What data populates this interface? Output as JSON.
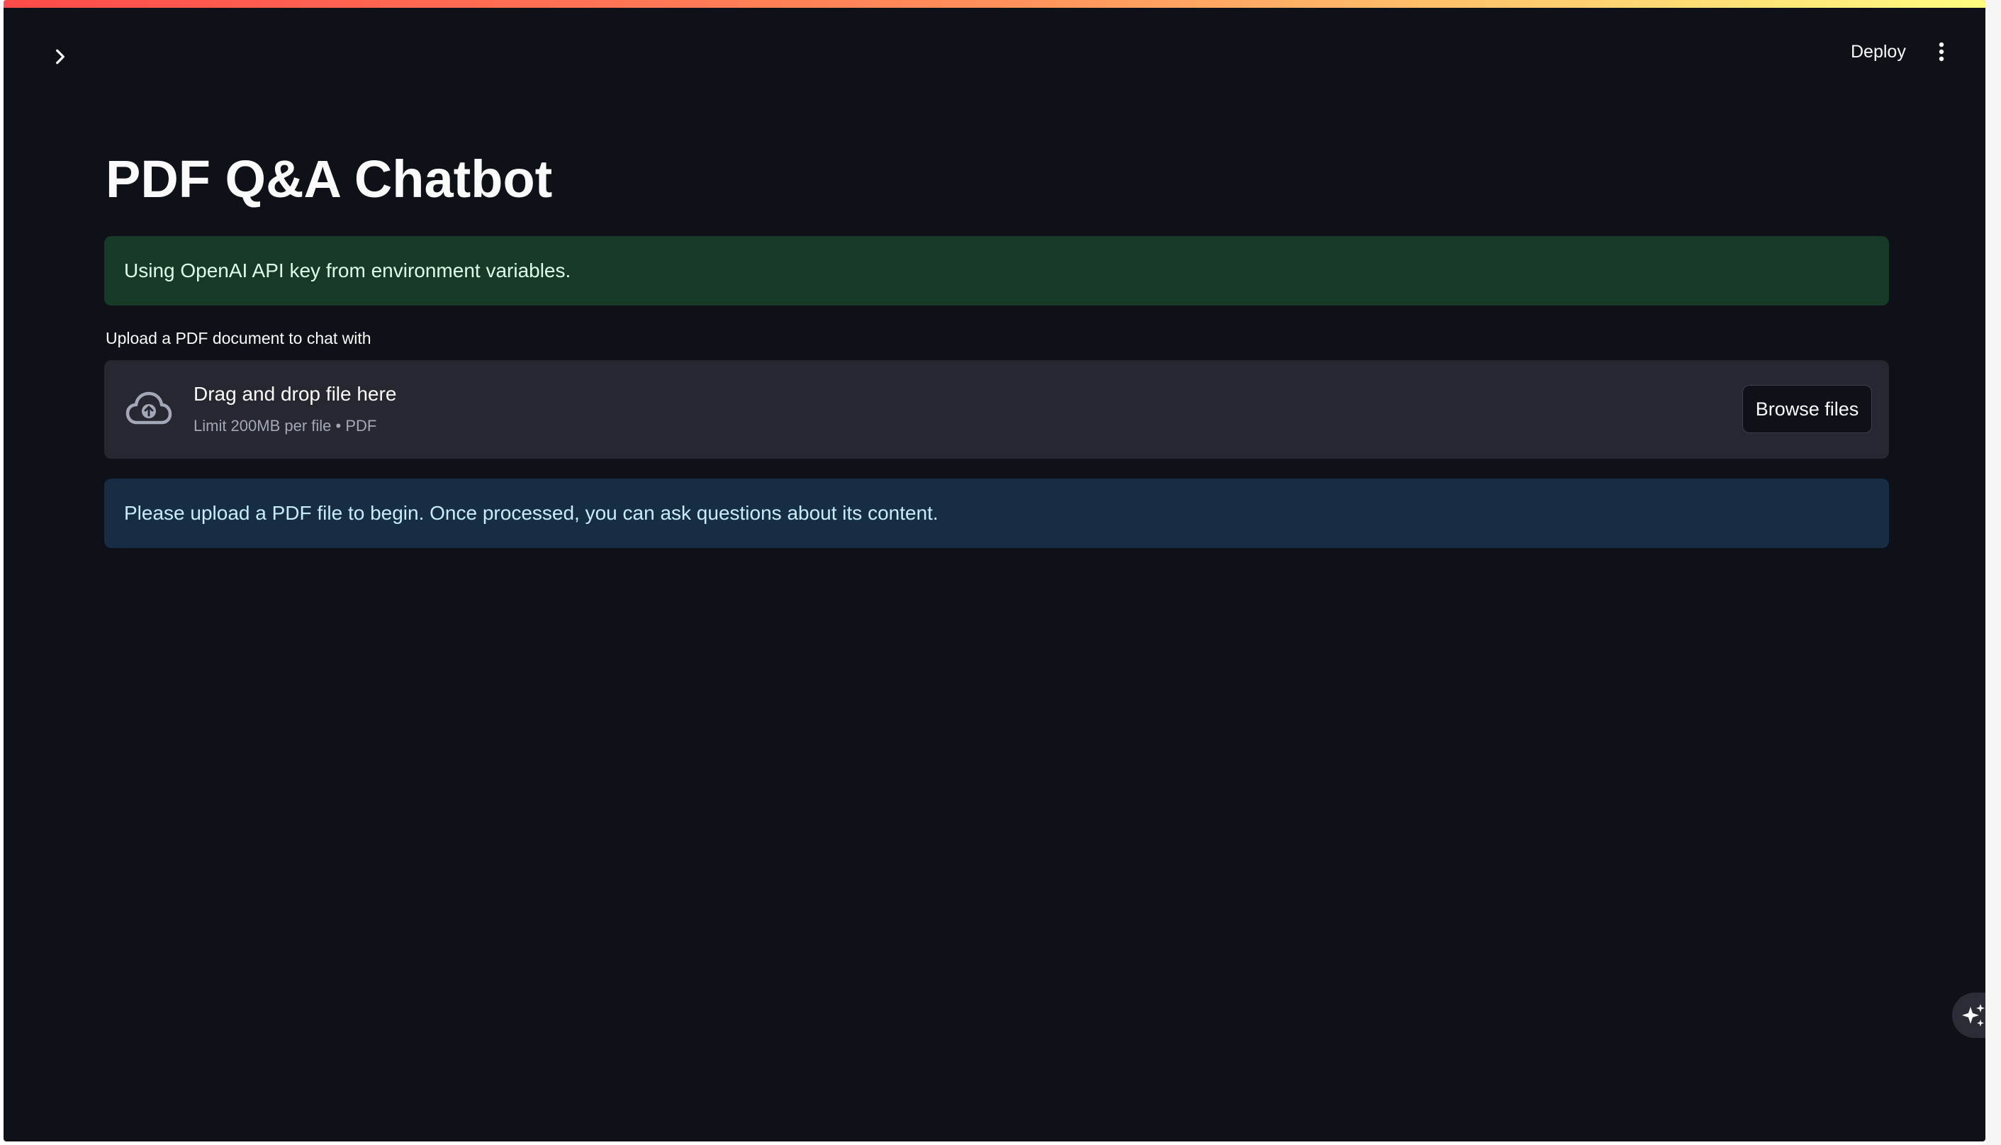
{
  "header": {
    "deploy_label": "Deploy",
    "menu_icon": "vertical-ellipsis-icon",
    "sidebar_toggle_icon": "chevron-right-icon"
  },
  "main": {
    "title": "PDF Q&A Chatbot",
    "success_message": "Using OpenAI API key from environment variables.",
    "uploader": {
      "label": "Upload a PDF document to chat with",
      "drop_title": "Drag and drop file here",
      "drop_subtitle": "Limit 200MB per file • PDF",
      "browse_label": "Browse files",
      "icon": "cloud-upload-icon"
    },
    "info_message": "Please upload a PDF file to begin. Once processed, you can ask questions about its content."
  },
  "floating": {
    "assistant_icon": "sparkles-icon"
  },
  "colors": {
    "background": "#0e1117",
    "success_bg": "#173928",
    "info_bg": "#172d43",
    "dropzone_bg": "#262730",
    "text": "#fafafa",
    "accent_gradient_start": "#ff4b4b",
    "accent_gradient_end": "#fffd80"
  }
}
